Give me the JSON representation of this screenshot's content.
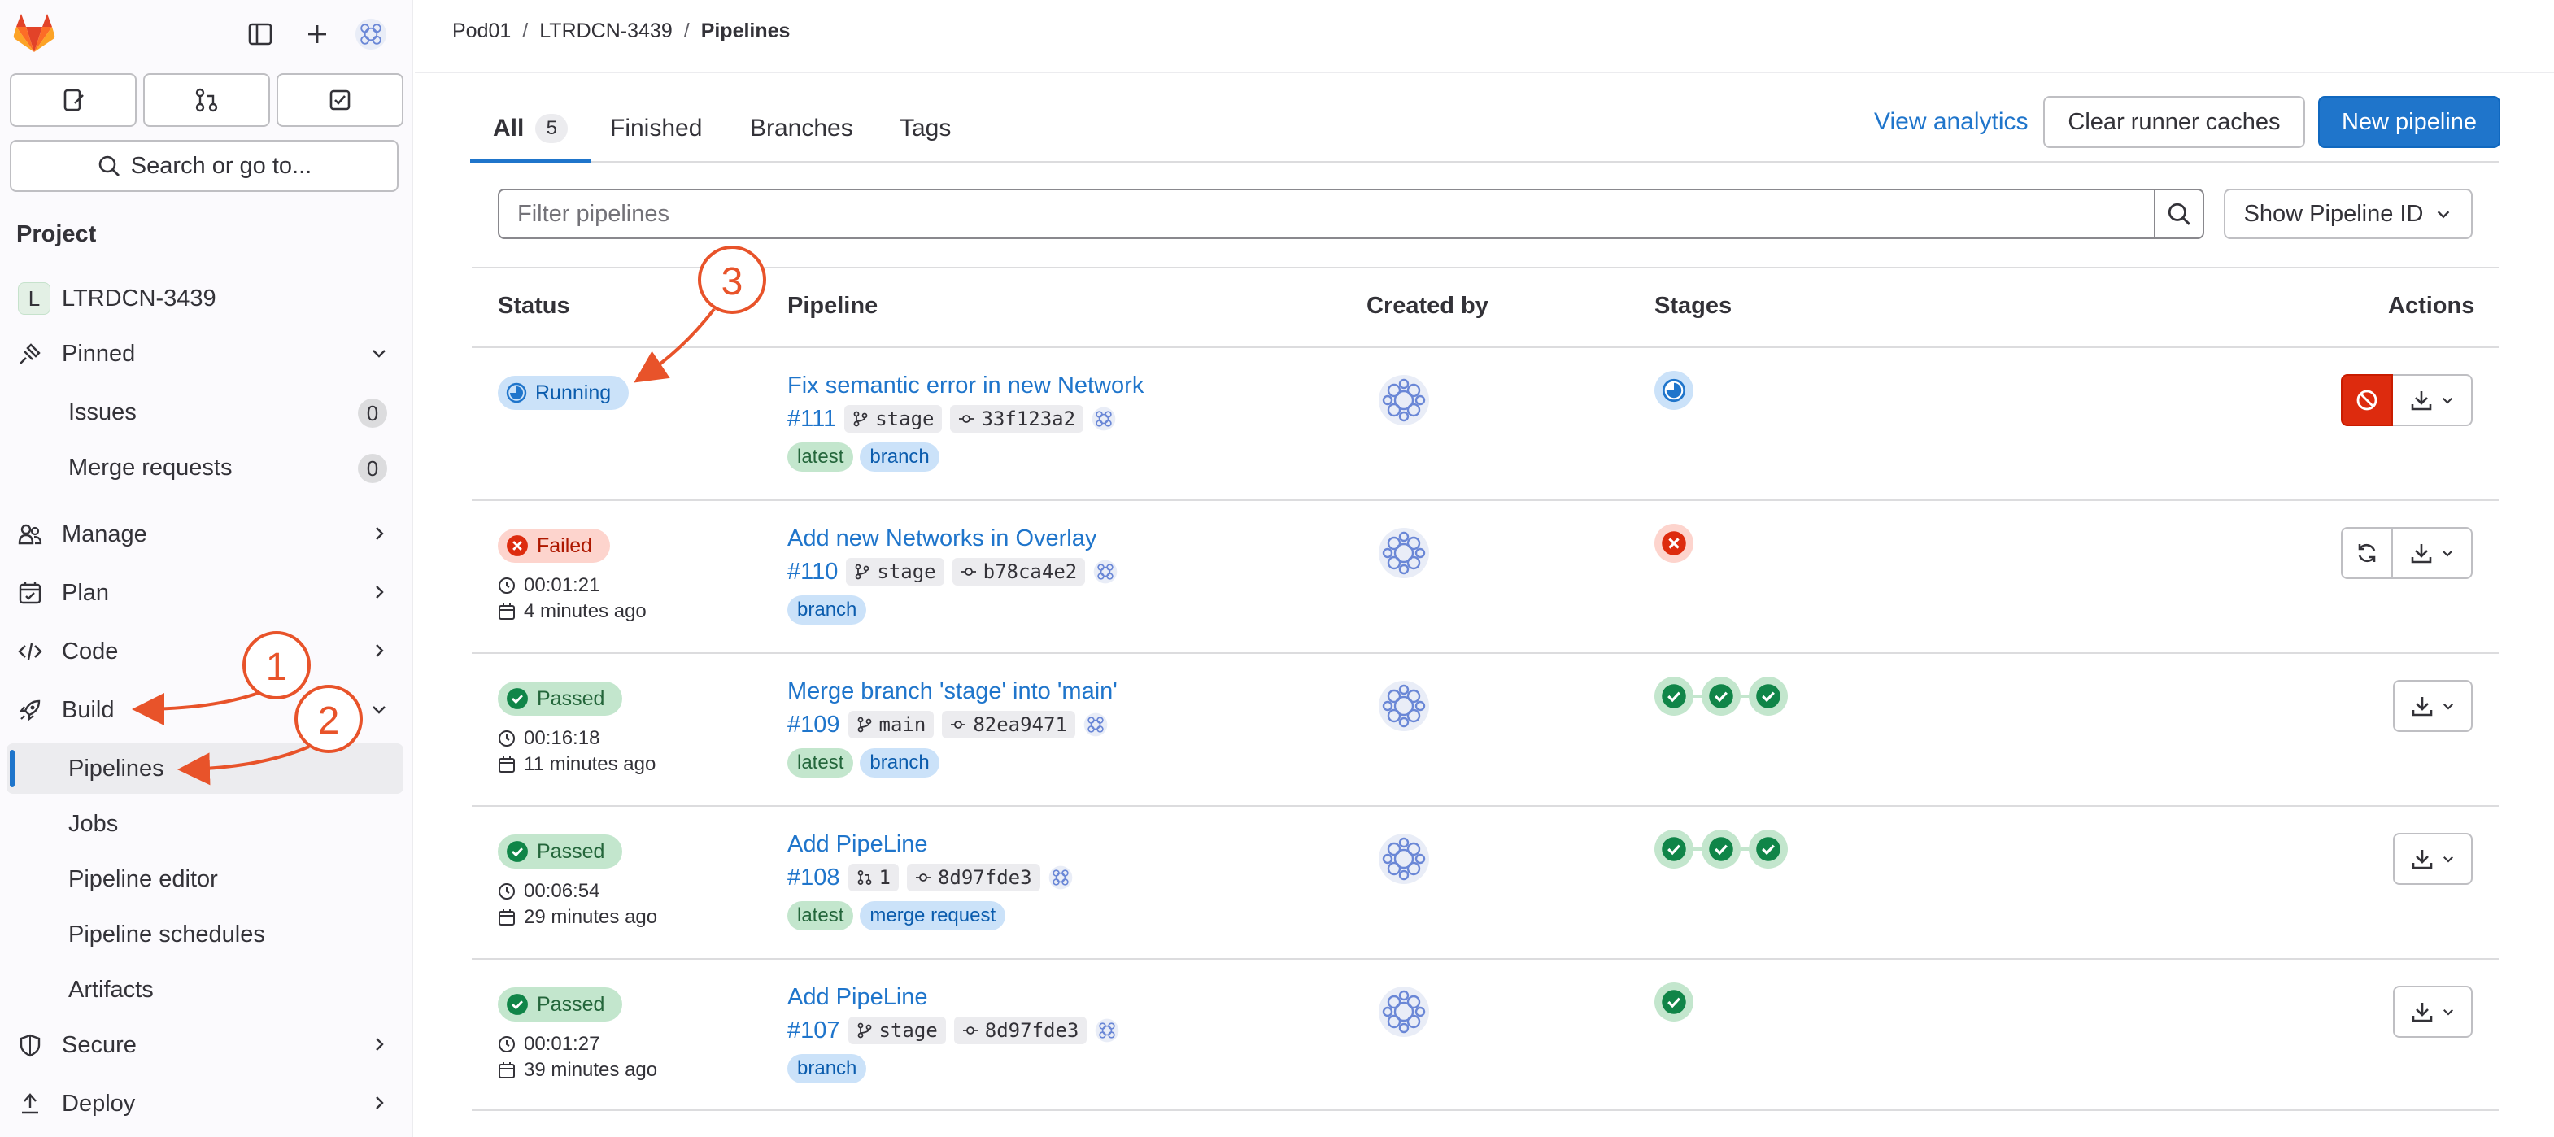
{
  "breadcrumb": [
    "Pod01",
    "LTRDCN-3439",
    "Pipelines"
  ],
  "sidebar": {
    "search_label": "Search or go to...",
    "section_title": "Project",
    "project": {
      "initial": "L",
      "name": "LTRDCN-3439"
    },
    "pinned": {
      "label": "Pinned",
      "items": [
        {
          "label": "Issues",
          "count": "0"
        },
        {
          "label": "Merge requests",
          "count": "0"
        }
      ]
    },
    "groups": [
      "Manage",
      "Plan",
      "Code",
      "Build"
    ],
    "build_items": [
      "Pipelines",
      "Jobs",
      "Pipeline editor",
      "Pipeline schedules",
      "Artifacts"
    ],
    "more_groups": [
      "Secure",
      "Deploy"
    ]
  },
  "tabs": [
    {
      "label": "All",
      "count": "5"
    },
    {
      "label": "Finished"
    },
    {
      "label": "Branches"
    },
    {
      "label": "Tags"
    }
  ],
  "header_actions": {
    "analytics": "View analytics",
    "clear": "Clear runner caches",
    "new": "New pipeline"
  },
  "filter": {
    "placeholder": "Filter pipelines",
    "select": "Show Pipeline ID"
  },
  "columns": [
    "Status",
    "Pipeline",
    "Created by",
    "Stages",
    "Actions"
  ],
  "pipelines": [
    {
      "status": "Running",
      "duration": "",
      "ago": "",
      "title": "Fix semantic error in new Network",
      "id": "#111",
      "ref": "stage",
      "sha": "33f123a2",
      "labels": [
        "latest",
        "branch"
      ]
    },
    {
      "status": "Failed",
      "duration": "00:01:21",
      "ago": "4 minutes ago",
      "title": "Add new Networks in Overlay",
      "id": "#110",
      "ref": "stage",
      "sha": "b78ca4e2",
      "labels": [
        "branch"
      ]
    },
    {
      "status": "Passed",
      "duration": "00:16:18",
      "ago": "11 minutes ago",
      "title": "Merge branch 'stage' into 'main'",
      "id": "#109",
      "ref": "main",
      "sha": "82ea9471",
      "labels": [
        "latest",
        "branch"
      ]
    },
    {
      "status": "Passed",
      "duration": "00:06:54",
      "ago": "29 minutes ago",
      "title": "Add PipeLine",
      "id": "#108",
      "ref": "1",
      "sha": "8d97fde3",
      "labels": [
        "latest",
        "merge request"
      ]
    },
    {
      "status": "Passed",
      "duration": "00:01:27",
      "ago": "39 minutes ago",
      "title": "Add PipeLine",
      "id": "#107",
      "ref": "stage",
      "sha": "8d97fde3",
      "labels": [
        "branch"
      ]
    }
  ],
  "annotations": [
    "1",
    "2",
    "3"
  ],
  "colors": {
    "accent": "#1f75cb",
    "annotation": "#e8532a",
    "success": "#108548",
    "danger": "#dd2b0e"
  }
}
